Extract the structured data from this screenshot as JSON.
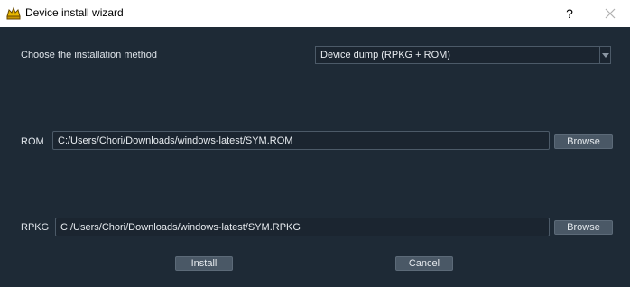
{
  "window": {
    "title": "Device install wizard",
    "help_label": "?"
  },
  "method": {
    "label": "Choose the installation method",
    "selected": "Device dump (RPKG + ROM)"
  },
  "rom": {
    "label": "ROM",
    "path": "C:/Users/Chori/Downloads/windows-latest/SYM.ROM",
    "browse_label": "Browse"
  },
  "rpkg": {
    "label": "RPKG",
    "path": "C:/Users/Chori/Downloads/windows-latest/SYM.RPKG",
    "browse_label": "Browse"
  },
  "actions": {
    "install_label": "Install",
    "cancel_label": "Cancel"
  },
  "colors": {
    "background": "#1e2a36",
    "button": "#4a5866",
    "field": "#1b2530"
  }
}
